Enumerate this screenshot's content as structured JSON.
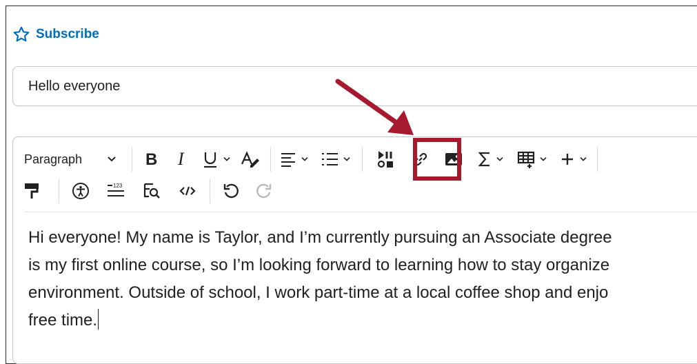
{
  "subscribe": {
    "label": "Subscribe",
    "icon": "star-outline-icon"
  },
  "title_field": {
    "value": "Hello everyone"
  },
  "toolbar": {
    "format_select": {
      "label": "Paragraph"
    },
    "row1": [
      {
        "name": "bold",
        "icon": "bold-icon"
      },
      {
        "name": "italic",
        "icon": "italic-icon"
      },
      {
        "name": "underline",
        "icon": "underline-icon"
      },
      {
        "name": "format-clear",
        "icon": "text-color-icon"
      },
      {
        "name": "align",
        "icon": "align-left-icon"
      },
      {
        "name": "list",
        "icon": "bullet-list-icon"
      },
      {
        "name": "media",
        "icon": "insert-media-icon",
        "highlighted": true
      },
      {
        "name": "link",
        "icon": "link-icon"
      },
      {
        "name": "image",
        "icon": "image-icon"
      },
      {
        "name": "equation",
        "icon": "sigma-icon"
      },
      {
        "name": "table",
        "icon": "table-icon"
      },
      {
        "name": "more",
        "icon": "plus-icon"
      }
    ],
    "row2": [
      {
        "name": "format-painter",
        "icon": "paint-roller-icon"
      },
      {
        "name": "accessibility",
        "icon": "accessibility-icon"
      },
      {
        "name": "line-numbers",
        "icon": "line-numbers-icon"
      },
      {
        "name": "find",
        "icon": "find-replace-icon"
      },
      {
        "name": "source-code",
        "icon": "code-icon"
      },
      {
        "name": "undo",
        "icon": "undo-icon"
      },
      {
        "name": "redo",
        "icon": "redo-icon"
      }
    ]
  },
  "body": {
    "lines": [
      "Hi everyone! My name is Taylor, and I’m currently pursuing an Associate degree",
      "is my first online course, so I’m looking forward to learning how to stay organize",
      "environment. Outside of school, I work part-time at a local coffee shop and enjo",
      "free time."
    ]
  },
  "colors": {
    "accent": "#006fbf",
    "highlight": "#a6192e",
    "text": "#202122"
  }
}
